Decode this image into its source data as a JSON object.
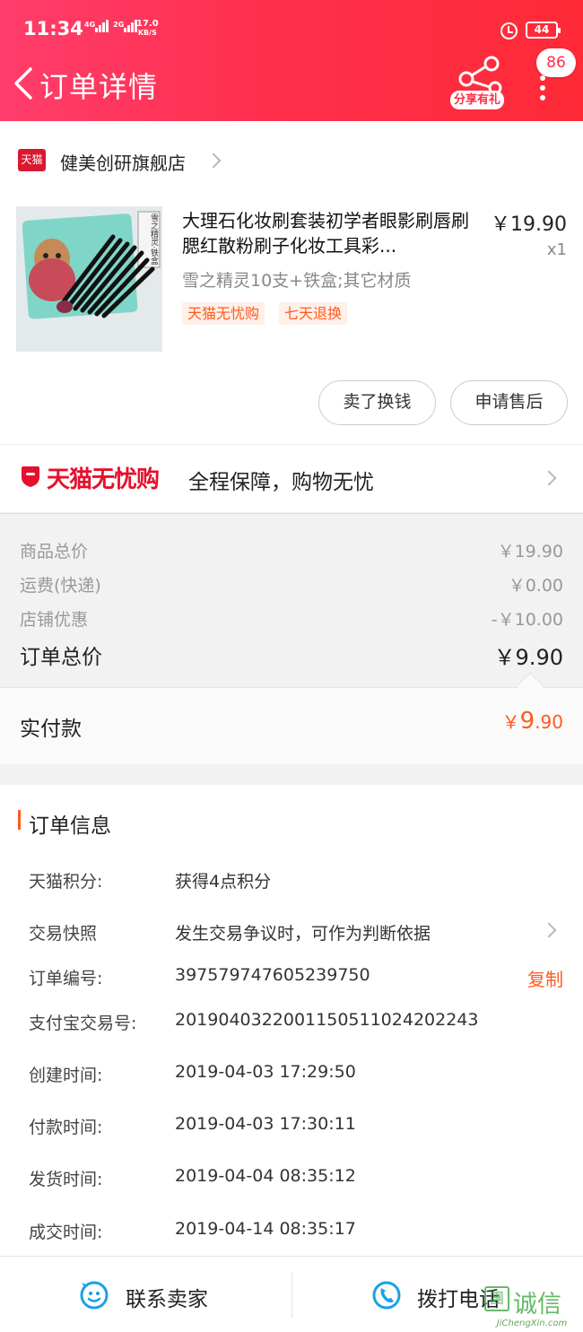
{
  "status_bar": {
    "time": "11:34",
    "net1": "4G",
    "net2": "2G",
    "speed_value": "17.0",
    "speed_unit": "KB/S",
    "battery": "44"
  },
  "header": {
    "title": "订单详情",
    "share_label": "分享有礼",
    "badge_count": "86"
  },
  "shop": {
    "logo_text": "天猫",
    "name": "健美创研旗舰店"
  },
  "product": {
    "title": "大理石化妆刷套装初学者眼影刷唇刷腮红散粉刷子化妆工具彩...",
    "price": "￥19.90",
    "qty": "x1",
    "sku": "雪之精灵10支+铁盒;其它材质",
    "tags": [
      "天猫无忧购",
      "七天退换"
    ],
    "image_box_text": "雪之精灵·铁盒"
  },
  "actions": {
    "sell": "卖了换钱",
    "after_sale": "申请售后"
  },
  "worry_free": {
    "logo": "天猫无忧购",
    "desc": "全程保障，购物无忧"
  },
  "price": {
    "rows": [
      {
        "label": "商品总价",
        "value": "￥19.90"
      },
      {
        "label": "运费(快递)",
        "value": "￥0.00"
      },
      {
        "label": "店铺优惠",
        "value": "-￥10.00"
      }
    ],
    "total_label": "订单总价",
    "total_value": "￥9.90",
    "paid_label": "实付款",
    "paid_symbol": "￥",
    "paid_int": "9",
    "paid_dec": ".90"
  },
  "order_info": {
    "title": "订单信息",
    "rows": [
      {
        "label": "天猫积分:",
        "value": "获得4点积分"
      },
      {
        "label": "交易快照",
        "value": "发生交易争议时，可作为判断依据"
      },
      {
        "label": "订单编号:",
        "value": "397579747605239750"
      },
      {
        "label": "支付宝交易号:",
        "value": "2019040322001150511024202243"
      },
      {
        "label": "创建时间:",
        "value": "2019-04-03 17:29:50"
      },
      {
        "label": "付款时间:",
        "value": "2019-04-03 17:30:11"
      },
      {
        "label": "发货时间:",
        "value": "2019-04-04 08:35:12"
      },
      {
        "label": "成交时间:",
        "value": "2019-04-14 08:35:17"
      }
    ],
    "copy_label": "复制"
  },
  "bottom_bar": {
    "contact_seller": "联系卖家",
    "call_phone": "拨打电话"
  },
  "watermark": {
    "chars": "诚信",
    "mark": "團",
    "url": "JiChengXin.com"
  },
  "colors": {
    "header_start": "#ff3d6b",
    "header_end": "#ff2a36",
    "accent_orange": "#ff5a1f",
    "tmall_red": "#e6102d",
    "icon_blue": "#1aa1e6"
  }
}
